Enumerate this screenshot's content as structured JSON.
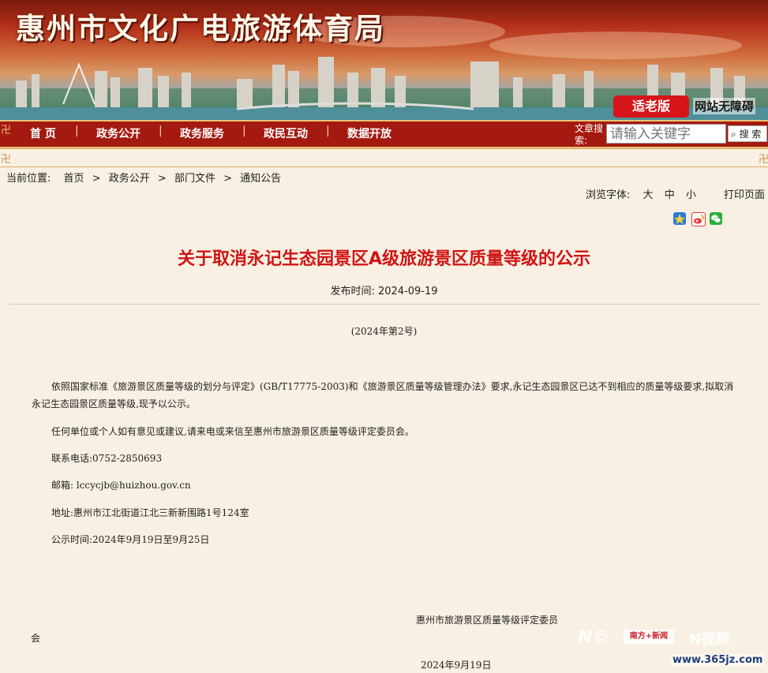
{
  "site": {
    "title": "惠州市文化广电旅游体育局",
    "old_mode_label": "适老版",
    "accessibility_label": "网站无障碍"
  },
  "nav": {
    "items": [
      "首 页",
      "政务公开",
      "政务服务",
      "政民互动",
      "数据开放"
    ],
    "separator": "|",
    "search_label": "文章搜索:",
    "search_placeholder": "请输入关键字",
    "search_button": "搜 索"
  },
  "breadcrumb": {
    "prefix": "当前位置:",
    "items": [
      "首页",
      ">",
      "政务公开",
      ">",
      "部门文件",
      ">",
      "通知公告"
    ]
  },
  "tools": {
    "font_label": "浏览字体:",
    "font_large": "大",
    "font_medium": "中",
    "font_small": "小",
    "print": "打印页面"
  },
  "share_icons": [
    "qzone-icon",
    "weibo-icon",
    "wechat-icon"
  ],
  "article": {
    "title": "关于取消永记生态园景区A级旅游景区质量等级的公示",
    "publish_time": "发布时间: 2024-09-19",
    "doc_number": "(2024年第2号)",
    "paragraph1": "依照国家标准《旅游景区质量等级的划分与评定》(GB/T17775-2003)和《旅游景区质量等级管理办法》要求,永记生态园景区已达不到相应的质量等级要求,拟取消永记生态园景区质量等级,现予以公示。",
    "paragraph2": "任何单位或个人如有意见或建议,请来电或来信至惠州市旅游景区质量等级评定委员会。",
    "phone": "联系电话:0752-2850693",
    "email": "邮箱: lccycjb@huizhou.gov.cn",
    "address": "地址:惠州市江北街道江北三新新围路1号124室",
    "period": "公示时间:2024年9月19日至9月25日",
    "signature_line1": "惠州市旅游景区质量等级评定委员",
    "signature_line2": "会",
    "signature_date": "2024年9月19日"
  },
  "watermarks": {
    "brand1": "N©",
    "brand1_tag": "南方+新闻",
    "brand2": "N视频",
    "site": "www.365jz.com"
  },
  "colors": {
    "nav_bg": "#a41a10",
    "title_red": "#d01414",
    "old_mode_bg": "#d7141a",
    "page_bg": "#f8f0e2"
  }
}
